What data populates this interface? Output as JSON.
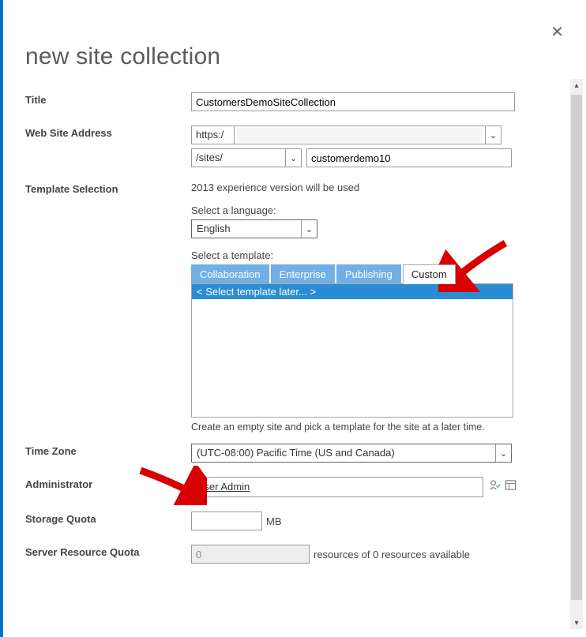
{
  "header": {
    "title": "new site collection"
  },
  "labels": {
    "title": "Title",
    "address": "Web Site Address",
    "template": "Template Selection",
    "timezone": "Time Zone",
    "admin": "Administrator",
    "storage": "Storage Quota",
    "srq": "Server Resource Quota"
  },
  "title_value": "CustomersDemoSiteCollection",
  "address": {
    "protocol": "https:/",
    "sites_path": "/sites/",
    "path_value": "customerdemo10"
  },
  "template": {
    "experience_text": "2013 experience version will be used",
    "lang_label": "Select a language:",
    "lang_value": "English",
    "tmpl_label": "Select a template:",
    "tabs": [
      "Collaboration",
      "Enterprise",
      "Publishing",
      "Custom"
    ],
    "active_tab_index": 3,
    "selected_option": "< Select template later... >",
    "help_text": "Create an empty site and pick a template for the site at a later time."
  },
  "timezone_value": "(UTC-08:00) Pacific Time (US and Canada)",
  "admin_value": "User Admin",
  "storage": {
    "value": "",
    "unit": "MB"
  },
  "srq": {
    "value": "0",
    "suffix": "resources of 0 resources available"
  }
}
